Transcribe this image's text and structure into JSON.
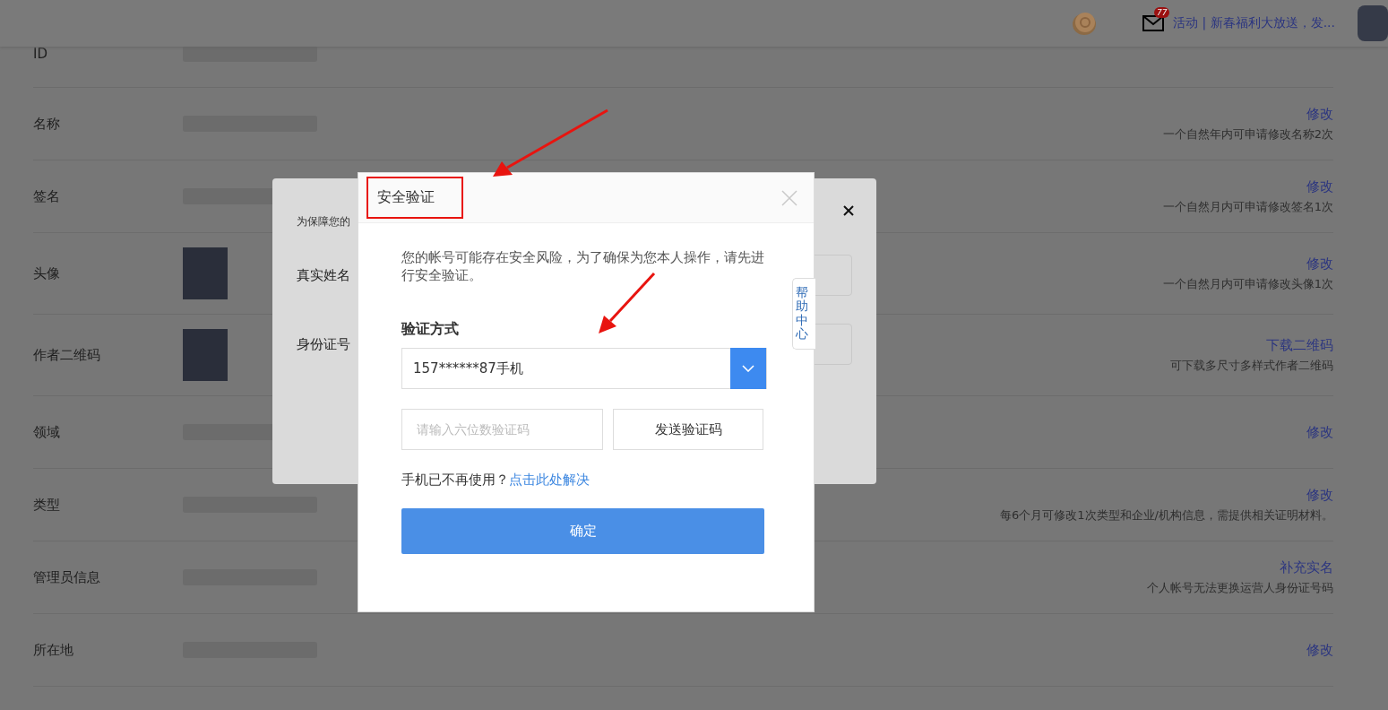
{
  "header": {
    "mail_badge": "77",
    "activity": "活动 | 新春福利大放送，发..."
  },
  "profile_rows": [
    {
      "label": "ID",
      "kind": "text"
    },
    {
      "label": "名称",
      "kind": "text",
      "action": "修改",
      "hint": "一个自然年内可申请修改名称2次"
    },
    {
      "label": "签名",
      "kind": "text",
      "action": "修改",
      "hint": "一个自然月内可申请修改签名1次"
    },
    {
      "label": "头像",
      "kind": "image",
      "action": "修改",
      "hint": "一个自然月内可申请修改头像1次"
    },
    {
      "label": "作者二维码",
      "kind": "image",
      "action": "下载二维码",
      "hint": "可下载多尺寸多样式作者二维码"
    },
    {
      "label": "领域",
      "kind": "text",
      "action": "修改"
    },
    {
      "label": "类型",
      "kind": "text",
      "action": "修改",
      "hint": "每6个月可修改1次类型和企业/机构信息，需提供相关证明材料。"
    },
    {
      "label": "管理员信息",
      "kind": "text",
      "action": "补充实名",
      "hint": "个人帐号无法更换运营人身份证号码"
    },
    {
      "label": "所在地",
      "kind": "text",
      "action": "修改"
    }
  ],
  "back_dialog": {
    "intro": "为保障您的",
    "fields": [
      {
        "label": "真实姓名"
      },
      {
        "label": "身份证号"
      }
    ]
  },
  "dialog": {
    "title": "安全验证",
    "message": "您的帐号可能存在安全风险，为了确保为您本人操作，请先进行安全验证。",
    "method_label": "验证方式",
    "method_value": "157******87手机",
    "code_placeholder": "请输入六位数验证码",
    "send_button": "发送验证码",
    "help_text": "手机已不再使用？",
    "help_link": "点击此处解决",
    "confirm_button": "确定"
  },
  "help_tab": "帮助中心"
}
